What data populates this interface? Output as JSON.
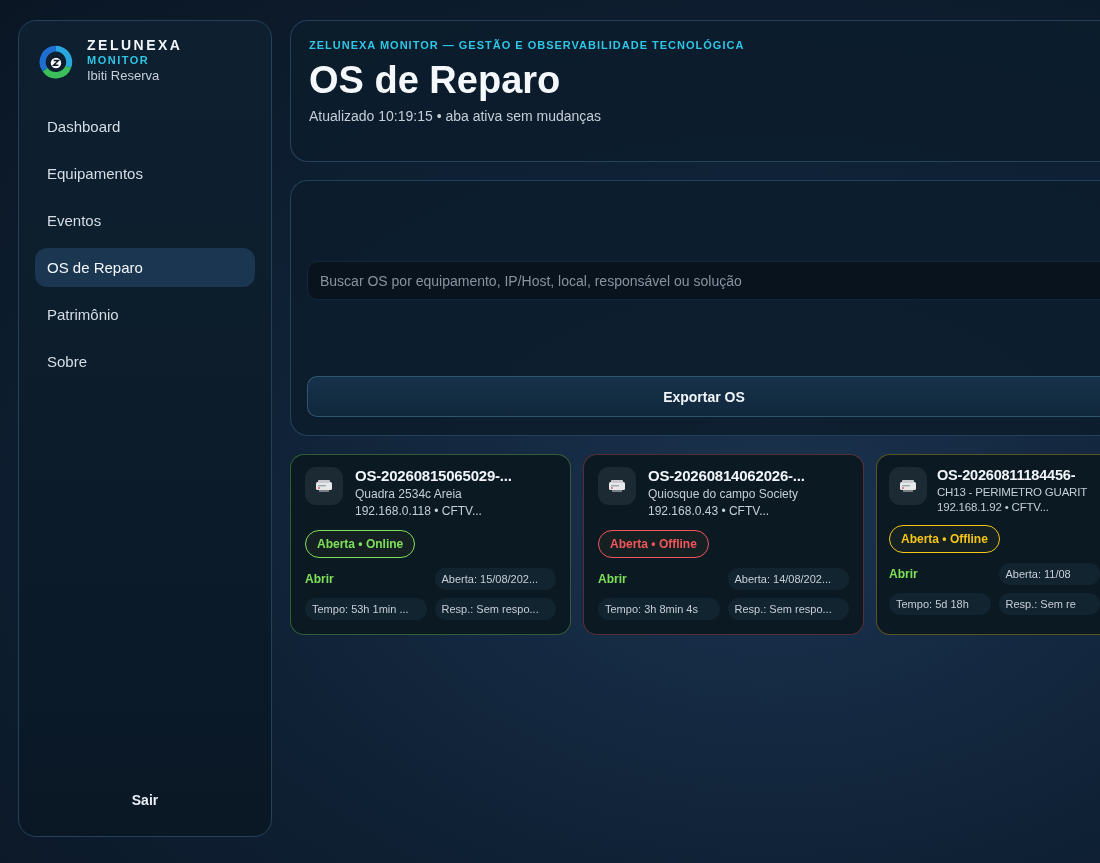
{
  "brand": {
    "name": "ZELUNEXA",
    "product": "MONITOR",
    "site": "Ibiti Reserva"
  },
  "nav": [
    {
      "label": "Dashboard",
      "selected": false
    },
    {
      "label": "Equipamentos",
      "selected": false
    },
    {
      "label": "Eventos",
      "selected": false
    },
    {
      "label": "OS de Reparo",
      "selected": true
    },
    {
      "label": "Patrimônio",
      "selected": false
    },
    {
      "label": "Sobre",
      "selected": false
    }
  ],
  "logout": "Sair",
  "header": {
    "eyebrow": "ZELUNEXA MONITOR — GESTÃO E OBSERVABILIDADE TECNOLÓGICA",
    "title": "OS de Reparo",
    "subtitle": "Atualizado 10:19:15 • aba ativa sem mudanças"
  },
  "search": {
    "placeholder": "Buscar OS por equipamento, IP/Host, local, responsável ou solução"
  },
  "export_button": "Exportar OS",
  "orders": [
    {
      "id": "OS-20260815065029-...",
      "location": "Quadra 2534c Areia",
      "host": "192.168.0.118 • CFTV...",
      "status": "Aberta • Online",
      "color": "#7ee05a",
      "action": "Abrir",
      "opened": "Aberta: 15/08/202...",
      "duration": "Tempo: 53h 1min ...",
      "owner": "Resp.: Sem respo..."
    },
    {
      "id": "OS-20260814062026-...",
      "location": "Quiosque do campo Society",
      "host": "192.168.0.43 • CFTV...",
      "status": "Aberta • Offline",
      "color": "#f2555a",
      "action": "Abrir",
      "opened": "Aberta: 14/08/202...",
      "duration": "Tempo: 3h 8min 4s",
      "owner": "Resp.: Sem respo..."
    },
    {
      "id": "OS-20260811184456-",
      "location": "CH13 - PERIMETRO GUARIT",
      "host": "192.168.1.92 • CFTV...",
      "status": "Aberta • Offline",
      "color": "#f5c518",
      "action": "Abrir",
      "opened": "Aberta: 11/08",
      "duration": "Tempo: 5d 18h",
      "owner": "Resp.: Sem re"
    }
  ]
}
